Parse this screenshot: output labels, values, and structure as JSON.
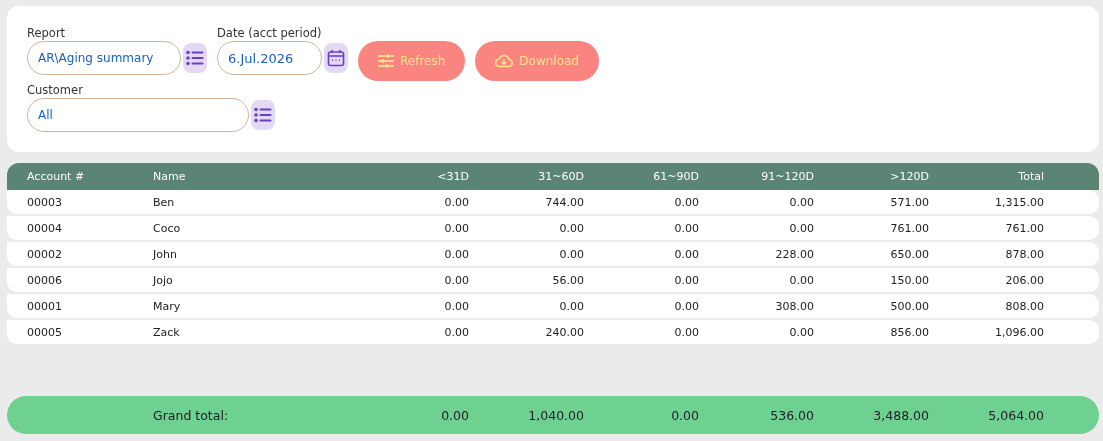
{
  "filters": {
    "report": {
      "label": "Report",
      "value": "AR\\Aging summary"
    },
    "date": {
      "label": "Date (acct period)",
      "value": "6.Jul.2026"
    },
    "customer": {
      "label": "Customer",
      "value": "All"
    }
  },
  "buttons": [
    {
      "label": "Refresh",
      "kind": "refresh"
    },
    {
      "label": "Download",
      "kind": "download"
    }
  ],
  "table": {
    "columns": [
      "Account #",
      "Name",
      "<31D",
      "31~60D",
      "61~90D",
      "91~120D",
      ">120D",
      "Total"
    ],
    "rows": [
      [
        "00003",
        "Ben",
        "0.00",
        "744.00",
        "0.00",
        "0.00",
        "571.00",
        "1,315.00"
      ],
      [
        "00004",
        "Coco",
        "0.00",
        "0.00",
        "0.00",
        "0.00",
        "761.00",
        "761.00"
      ],
      [
        "00002",
        "John",
        "0.00",
        "0.00",
        "0.00",
        "228.00",
        "650.00",
        "878.00"
      ],
      [
        "00006",
        "Jojo",
        "0.00",
        "56.00",
        "0.00",
        "0.00",
        "150.00",
        "206.00"
      ],
      [
        "00001",
        "Mary",
        "0.00",
        "0.00",
        "0.00",
        "308.00",
        "500.00",
        "808.00"
      ],
      [
        "00005",
        "Zack",
        "0.00",
        "240.00",
        "0.00",
        "0.00",
        "856.00",
        "1,096.00"
      ]
    ]
  },
  "grand_total": {
    "label": "Grand total:",
    "values": [
      "0.00",
      "1,040.00",
      "0.00",
      "536.00",
      "3,488.00",
      "5,064.00"
    ]
  }
}
